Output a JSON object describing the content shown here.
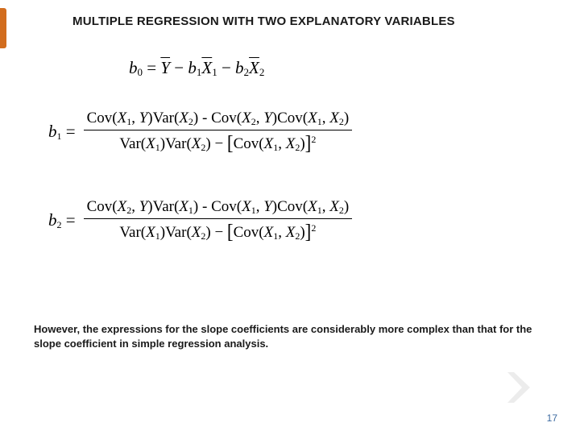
{
  "title": "MULTIPLE REGRESSION WITH TWO EXPLANATORY VARIABLES",
  "eq0": {
    "lhs_var": "b",
    "lhs_sub": "0",
    "eq": " = ",
    "term1_var": "Y",
    "minus1": " − ",
    "term2_coef": "b",
    "term2_coefsub": "1",
    "term2_var": "X",
    "term2_varsub": "1",
    "minus2": " − ",
    "term3_coef": "b",
    "term3_coefsub": "2",
    "term3_var": "X",
    "term3_varsub": "2"
  },
  "eq1": {
    "lhs_var": "b",
    "lhs_sub": "1",
    "eq": " = ",
    "num_a_fn": "Cov(",
    "num_a_arg1": "X",
    "num_a_arg1sub": "1",
    "num_a_sep": ", ",
    "num_a_arg2": "Y",
    "num_a_close": ")",
    "num_b_fn": "Var(",
    "num_b_arg": "X",
    "num_b_argsub": "2",
    "num_b_close": ") - ",
    "num_c_fn": "Cov(",
    "num_c_arg1": "X",
    "num_c_arg1sub": "2",
    "num_c_sep": ", ",
    "num_c_arg2": "Y",
    "num_c_close": ")",
    "num_d_fn": "Cov(",
    "num_d_arg1": "X",
    "num_d_arg1sub": "1",
    "num_d_sep": ", ",
    "num_d_arg2": "X",
    "num_d_arg2sub": "2",
    "num_d_close": ")",
    "den_a_fn": "Var(",
    "den_a_arg": "X",
    "den_a_argsub": "1",
    "den_a_close": ")",
    "den_b_fn": "Var(",
    "den_b_arg": "X",
    "den_b_argsub": "2",
    "den_b_close": ") − ",
    "den_c_fn": "Cov(",
    "den_c_arg1": "X",
    "den_c_arg1sub": "1",
    "den_c_sep": ", ",
    "den_c_arg2": "X",
    "den_c_arg2sub": "2",
    "den_c_close": ")",
    "den_exp": "2"
  },
  "eq2": {
    "lhs_var": "b",
    "lhs_sub": "2",
    "eq": " = ",
    "num_a_fn": "Cov(",
    "num_a_arg1": "X",
    "num_a_arg1sub": "2",
    "num_a_sep": ", ",
    "num_a_arg2": "Y",
    "num_a_close": ")",
    "num_b_fn": "Var(",
    "num_b_arg": "X",
    "num_b_argsub": "1",
    "num_b_close": ") - ",
    "num_c_fn": "Cov(",
    "num_c_arg1": "X",
    "num_c_arg1sub": "1",
    "num_c_sep": ", ",
    "num_c_arg2": "Y",
    "num_c_close": ")",
    "num_d_fn": "Cov(",
    "num_d_arg1": "X",
    "num_d_arg1sub": "1",
    "num_d_sep": ", ",
    "num_d_arg2": "X",
    "num_d_arg2sub": "2",
    "num_d_close": ")",
    "den_a_fn": "Var(",
    "den_a_arg": "X",
    "den_a_argsub": "1",
    "den_a_close": ")",
    "den_b_fn": "Var(",
    "den_b_arg": "X",
    "den_b_argsub": "2",
    "den_b_close": ") − ",
    "den_c_fn": "Cov(",
    "den_c_arg1": "X",
    "den_c_arg1sub": "1",
    "den_c_sep": ", ",
    "den_c_arg2": "X",
    "den_c_arg2sub": "2",
    "den_c_close": ")",
    "den_exp": "2"
  },
  "body_text": "However, the expressions for the slope coefficients are considerably more complex than that for the slope coefficient in simple regression analysis.",
  "page_number": "17",
  "colors": {
    "accent": "#d26d1e",
    "page_num": "#3c6aa0"
  }
}
